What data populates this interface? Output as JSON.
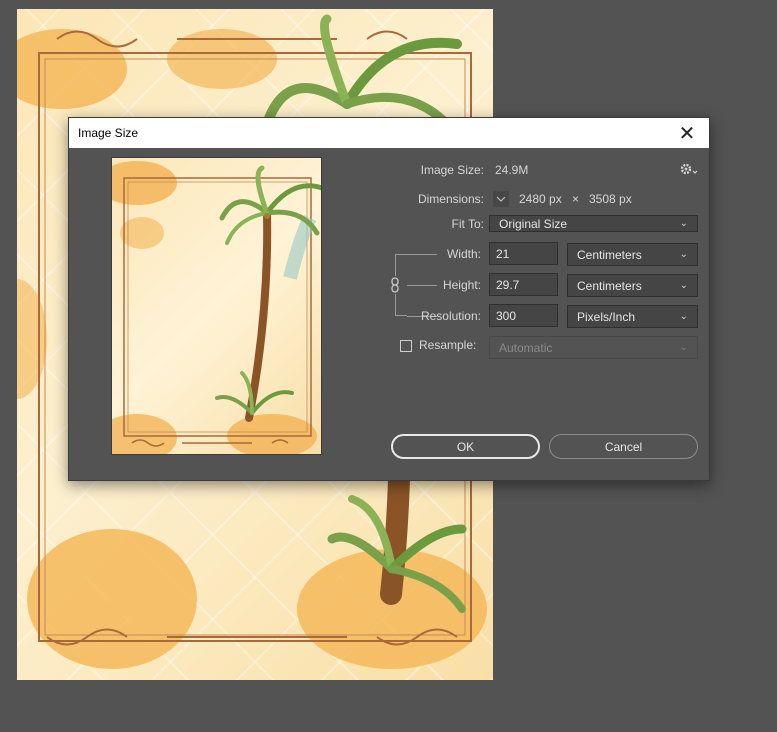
{
  "dialog": {
    "title": "Image Size",
    "close_symbol": "✕"
  },
  "info": {
    "image_size_label": "Image Size:",
    "image_size_value": "24.9M",
    "dimensions_label": "Dimensions:",
    "dimensions_width": "2480 px",
    "dimensions_sep": "×",
    "dimensions_height": "3508 px",
    "fit_to_label": "Fit To:",
    "fit_to_value": "Original Size"
  },
  "fields": {
    "width_label": "Width:",
    "width_value": "21",
    "width_unit": "Centimeters",
    "height_label": "Height:",
    "height_value": "29.7",
    "height_unit": "Centimeters",
    "resolution_label": "Resolution:",
    "resolution_value": "300",
    "resolution_unit": "Pixels/Inch"
  },
  "resample": {
    "label": "Resample:",
    "checked": false,
    "value": "Automatic"
  },
  "buttons": {
    "ok": "OK",
    "cancel": "Cancel"
  },
  "icons": {
    "settings": "gear-icon",
    "link": "link-chain-icon",
    "dimensions_toggle": "chevron-down-icon"
  },
  "colors": {
    "workspace_bg": "#535353",
    "canvas_paper": "#fdf0cf",
    "accent_orange": "#f4b85a"
  }
}
